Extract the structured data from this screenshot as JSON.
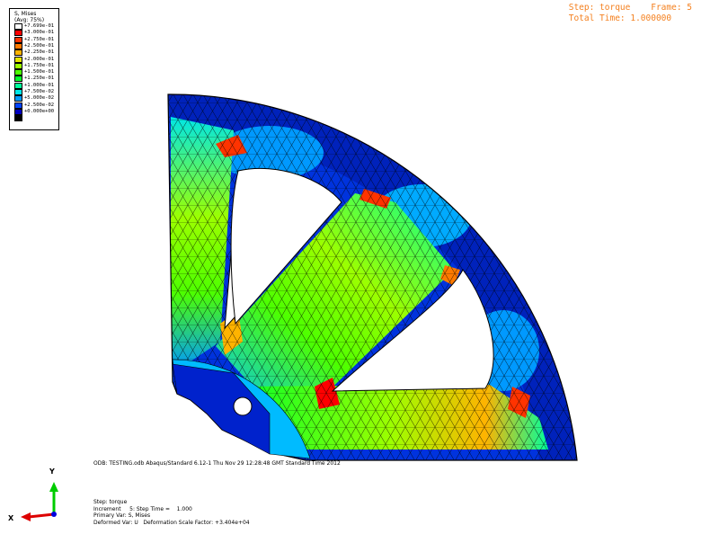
{
  "legend": {
    "title_line1": "S, Mises",
    "title_line2": "(Avg: 75%)",
    "entries": [
      {
        "label": "+7.699e-01",
        "color": "#ffffff"
      },
      {
        "label": "+3.000e-01",
        "color": "#ff0000"
      },
      {
        "label": "+2.750e-01",
        "color": "#ff3300"
      },
      {
        "label": "+2.500e-01",
        "color": "#ff7a00"
      },
      {
        "label": "+2.250e-01",
        "color": "#ffb300"
      },
      {
        "label": "+2.000e-01",
        "color": "#e6e600"
      },
      {
        "label": "+1.750e-01",
        "color": "#9cff00"
      },
      {
        "label": "+1.500e-01",
        "color": "#4dff00"
      },
      {
        "label": "+1.250e-01",
        "color": "#00ff2a"
      },
      {
        "label": "+1.000e-01",
        "color": "#00ff9c"
      },
      {
        "label": "+7.500e-02",
        "color": "#00e6e6"
      },
      {
        "label": "+5.000e-02",
        "color": "#0099ff"
      },
      {
        "label": "+2.500e-02",
        "color": "#0044ff"
      },
      {
        "label": "+0.000e+00",
        "color": "#0000bf"
      },
      {
        "label": "",
        "color": "#000000"
      }
    ]
  },
  "step_info": {
    "step_line": "Step: torque    Frame: 5",
    "time_line": "Total Time: 1.000000"
  },
  "odb_line": "ODB: TESTING.odb    Abaqus/Standard 6.12-1    Thu Nov 29 12:28:48 GMT Standard Time 2012",
  "status": {
    "step": "Step: torque",
    "increment": "Increment     5: Step Time =    1.000",
    "primary_var": "Primary Var: S, Mises",
    "deformed_var": "Deformed Var: U   Deformation Scale Factor: +3.404e+04"
  },
  "triad": {
    "y_label": "Y",
    "x_label": "X",
    "y_color": "#00cc00",
    "x_color": "#dd0000",
    "z_color": "#0000dd"
  },
  "colors": {
    "step_info": "#f4801f",
    "mesh_line": "#000000"
  }
}
